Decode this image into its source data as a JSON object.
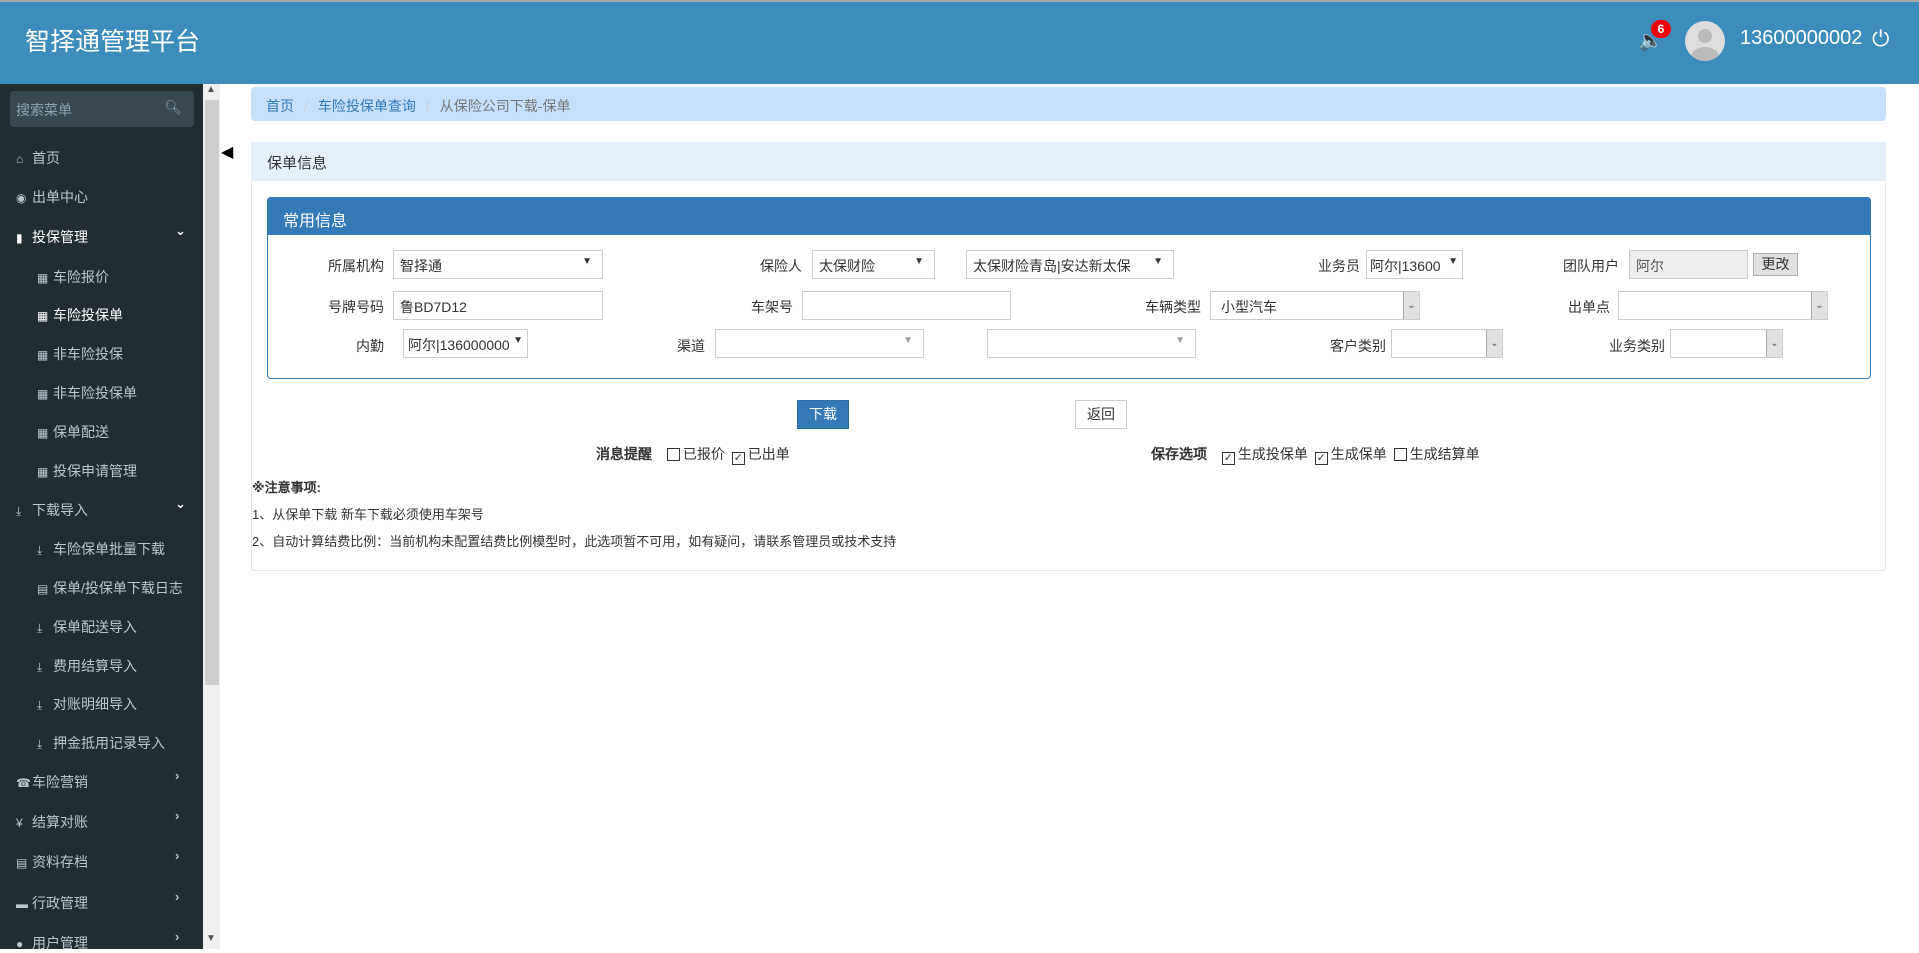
{
  "header": {
    "title": "智择通管理平台",
    "notification_count": "6",
    "username": "13600000002"
  },
  "sidebar": {
    "search_placeholder": "搜索菜单",
    "items": [
      {
        "label": "首页",
        "icon": "home-icon"
      },
      {
        "label": "出单中心",
        "icon": "globe-icon"
      },
      {
        "label": "投保管理",
        "icon": "file-icon",
        "expanded": true,
        "children": [
          {
            "label": "车险报价",
            "icon": "grid-icon"
          },
          {
            "label": "车险投保单",
            "icon": "grid-icon",
            "active": true
          },
          {
            "label": "非车险投保",
            "icon": "grid-icon"
          },
          {
            "label": "非车险投保单",
            "icon": "grid-icon"
          },
          {
            "label": "保单配送",
            "icon": "grid-icon"
          },
          {
            "label": "投保申请管理",
            "icon": "grid-icon"
          }
        ]
      },
      {
        "label": "下载导入",
        "icon": "import-icon",
        "expanded": true,
        "children": [
          {
            "label": "车险保单批量下载",
            "icon": "download-icon"
          },
          {
            "label": "保单/投保单下载日志",
            "icon": "list-icon"
          },
          {
            "label": "保单配送导入",
            "icon": "import-icon"
          },
          {
            "label": "费用结算导入",
            "icon": "import-icon"
          },
          {
            "label": "对账明细导入",
            "icon": "import-icon"
          },
          {
            "label": "押金抵用记录导入",
            "icon": "import-icon"
          }
        ]
      },
      {
        "label": "车险营销",
        "icon": "phone-icon"
      },
      {
        "label": "结算对账",
        "icon": "yen-icon"
      },
      {
        "label": "资料存档",
        "icon": "list-icon"
      },
      {
        "label": "行政管理",
        "icon": "folder-icon"
      },
      {
        "label": "用户管理",
        "icon": "user-icon"
      }
    ]
  },
  "breadcrumb": [
    "首页",
    "车险投保单查询",
    "从保险公司下载-保单"
  ],
  "panel": {
    "title": "保单信息",
    "section_title": "常用信息",
    "fields": {
      "org": {
        "label": "所属机构",
        "value": "智择通"
      },
      "insurer": {
        "label": "保险人",
        "value": "太保财险",
        "branch": "太保财险青岛|安达新太保"
      },
      "salesman": {
        "label": "业务员",
        "value": "阿尔|13600"
      },
      "team_user": {
        "label": "团队用户",
        "value": "阿尔",
        "button": "更改"
      },
      "plate": {
        "label": "号牌号码",
        "value": "鲁BD7D12"
      },
      "vin": {
        "label": "车架号",
        "value": ""
      },
      "vehicle_type": {
        "label": "车辆类型",
        "value": "小型汽车"
      },
      "issue_point": {
        "label": "出单点",
        "value": ""
      },
      "staff": {
        "label": "内勤",
        "value": "阿尔|136000000"
      },
      "channel": {
        "label": "渠道",
        "value": "",
        "sub": ""
      },
      "customer_type": {
        "label": "客户类别",
        "value": ""
      },
      "business_type": {
        "label": "业务类别",
        "value": ""
      }
    }
  },
  "actions": {
    "download": "下载",
    "back": "返回"
  },
  "reminder": {
    "label": "消息提醒",
    "options": [
      {
        "label": "已报价",
        "checked": false
      },
      {
        "label": "已出单",
        "checked": true
      }
    ]
  },
  "save_options": {
    "label": "保存选项",
    "options": [
      {
        "label": "生成投保单",
        "checked": true
      },
      {
        "label": "生成保单",
        "checked": true
      },
      {
        "label": "生成结算单",
        "checked": false
      }
    ]
  },
  "notes": {
    "title": "※注意事项:",
    "items": [
      "1、从保单下载 新车下载必须使用车架号",
      "2、自动计算结费比例：当前机构未配置结费比例模型时，此选项暂不可用，如有疑问，请联系管理员或技术支持"
    ]
  }
}
